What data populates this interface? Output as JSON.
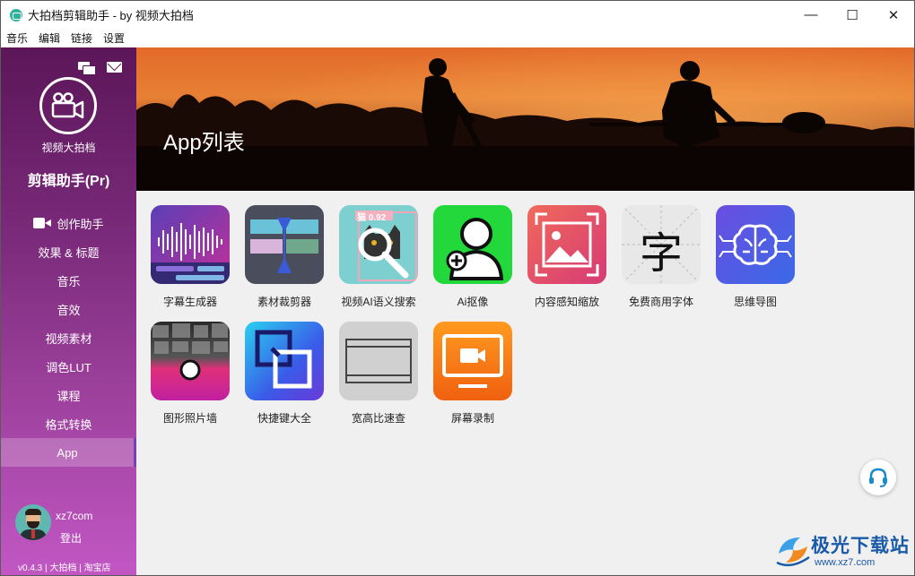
{
  "window": {
    "title": "大拍档剪辑助手 - by 视频大拍档",
    "minimize": "—",
    "maximize": "☐",
    "close": "✕"
  },
  "menu": [
    "音乐",
    "编辑",
    "链接",
    "设置"
  ],
  "sidebar": {
    "logo_label": "视频大拍档",
    "product_name": "剪辑助手(Pr)",
    "nav": [
      {
        "label": "创作助手",
        "icon": "camera-icon"
      },
      {
        "label": "效果 & 标题"
      },
      {
        "label": "音乐"
      },
      {
        "label": "音效"
      },
      {
        "label": "视频素材"
      },
      {
        "label": "调色LUT"
      },
      {
        "label": "课程"
      },
      {
        "label": "格式转换"
      },
      {
        "label": "App",
        "active": true
      }
    ],
    "username": "xz7com",
    "logout": "登出",
    "footer": "v0.4.3 | 大拍档 | 淘宝店"
  },
  "banner": {
    "title": "App列表"
  },
  "apps": [
    {
      "label": "字幕生成器",
      "icon": "subtitle-waveform-icon"
    },
    {
      "label": "素材裁剪器",
      "icon": "clip-trimmer-icon"
    },
    {
      "label": "视频AI语义搜索",
      "icon": "ai-search-icon",
      "badge": "猫 0.92"
    },
    {
      "label": "Ai抠像",
      "icon": "person-cutout-icon"
    },
    {
      "label": "内容感知缩放",
      "icon": "image-scale-icon"
    },
    {
      "label": "免费商用字体",
      "icon": "font-icon",
      "glyph": "字"
    },
    {
      "label": "思维导图",
      "icon": "brain-mindmap-icon"
    },
    {
      "label": "图形照片墙",
      "icon": "photo-wall-icon"
    },
    {
      "label": "快捷键大全",
      "icon": "shortcut-icon"
    },
    {
      "label": "宽高比速查",
      "icon": "aspect-ratio-icon"
    },
    {
      "label": "屏幕录制",
      "icon": "screen-record-icon"
    }
  ],
  "watermark": {
    "main": "极光下载站",
    "sub": "www.xz7.com"
  },
  "colors": {
    "sidebar_top": "#5b1658",
    "sidebar_bottom": "#c257c4",
    "main_bg": "#f0f0f0"
  }
}
